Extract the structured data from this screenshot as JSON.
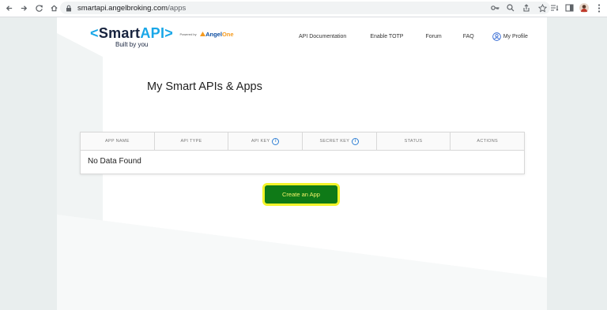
{
  "browser": {
    "url_domain": "smartapi.angelbroking.com",
    "url_path": "/apps"
  },
  "logo": {
    "open_bracket": "<",
    "smart": "Smart",
    "api": "API",
    "close_bracket": ">",
    "powered_by": "Powered by",
    "angel": "Angel",
    "one": "One",
    "tagline": "Built by you"
  },
  "nav": {
    "api_docs": "API Documentation",
    "enable_totp": "Enable TOTP",
    "forum": "Forum",
    "faq": "FAQ",
    "my_profile": "My Profile"
  },
  "page_title": "My Smart APIs & Apps",
  "table": {
    "columns": [
      "APP NAME",
      "API TYPE",
      "API KEY",
      "SECRET KEY",
      "STATUS",
      "ACTIONS"
    ],
    "info_icon_columns": [
      2,
      3
    ],
    "empty_message": "No Data Found"
  },
  "create_button": "Create an App",
  "colors": {
    "brand_dark": "#18243f",
    "brand_blue": "#19a7e8",
    "button_green": "#0f7a17",
    "highlight_yellow": "#f4f42a"
  }
}
